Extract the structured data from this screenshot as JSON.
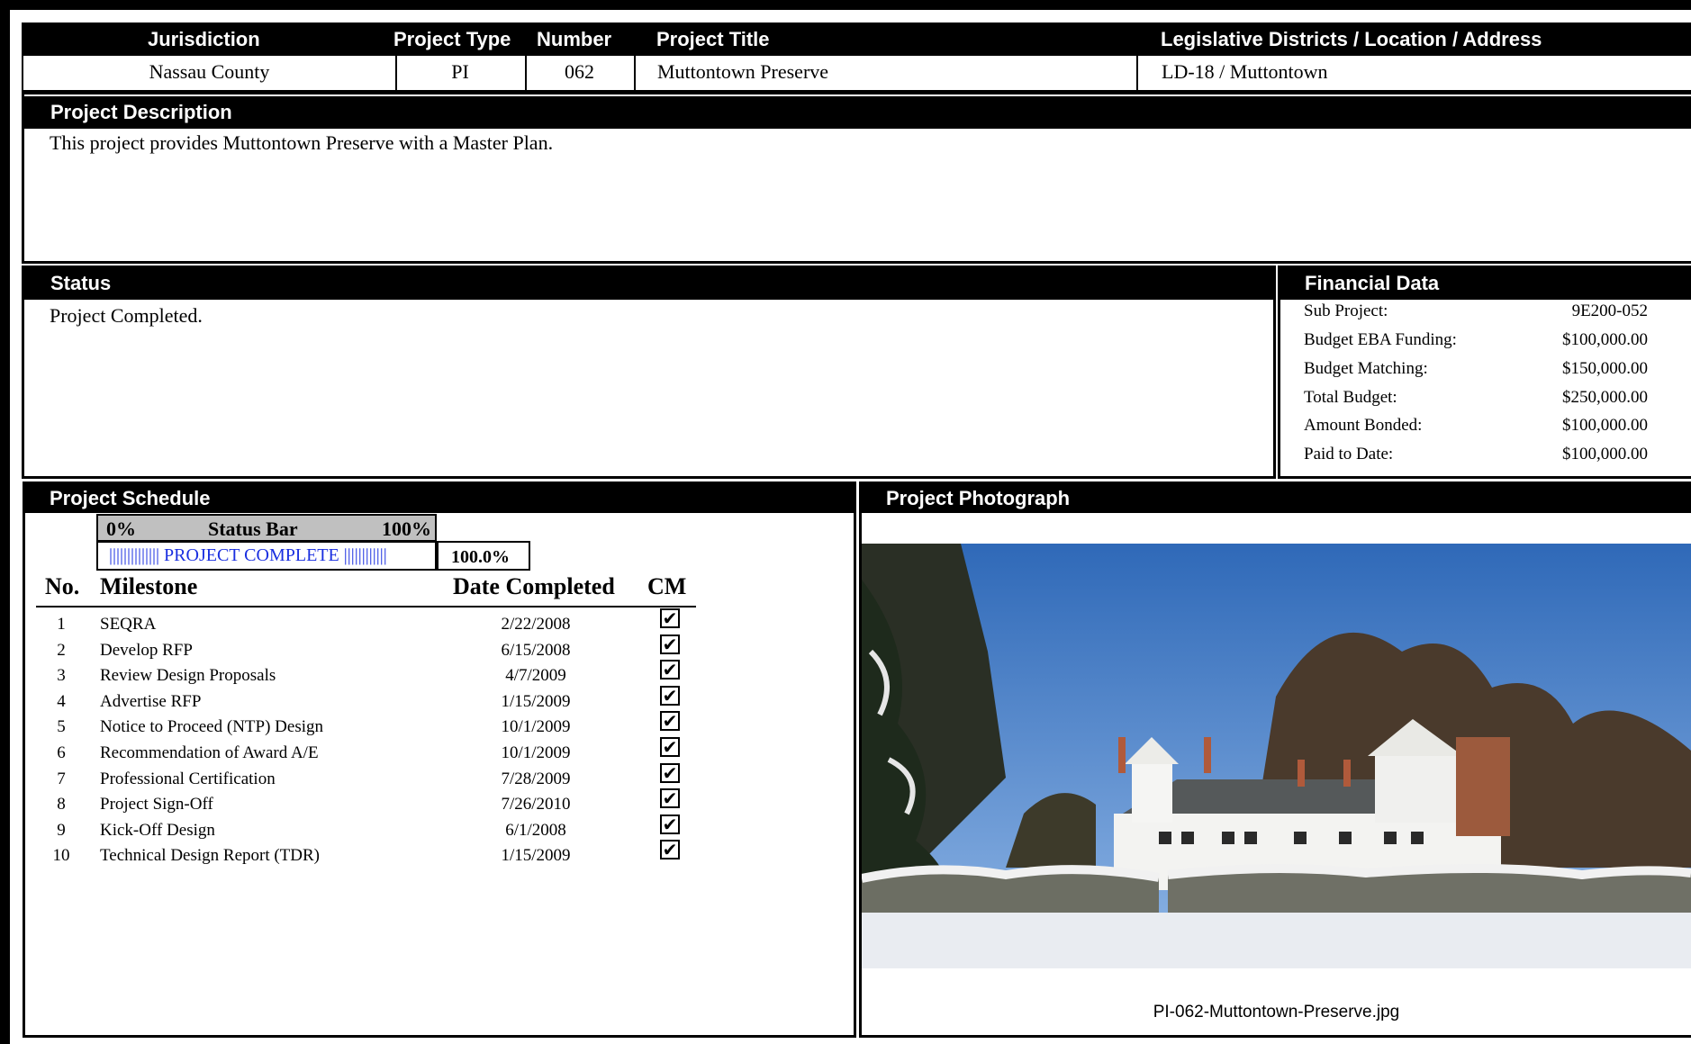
{
  "header": {
    "columns": {
      "jurisdiction": "Jurisdiction",
      "project_type": "Project Type",
      "number": "Number",
      "project_title": "Project Title",
      "location": "Legislative Districts / Location / Address"
    },
    "values": {
      "jurisdiction": "Nassau County",
      "project_type": "PI",
      "number": "062",
      "project_title": "Muttontown Preserve",
      "location": "LD-18 / Muttontown"
    }
  },
  "description": {
    "title": "Project Description",
    "text": "This project provides Muttontown Preserve with a Master Plan."
  },
  "status": {
    "title": "Status",
    "text": "Project Completed."
  },
  "financial": {
    "title": "Financial Data",
    "rows": [
      {
        "label": "Sub Project:",
        "value": "9E200-052"
      },
      {
        "label": "Budget EBA Funding:",
        "value": "$100,000.00"
      },
      {
        "label": "Budget Matching:",
        "value": "$150,000.00"
      },
      {
        "label": "Total Budget:",
        "value": "$250,000.00"
      },
      {
        "label": "Amount Bonded:",
        "value": "$100,000.00"
      },
      {
        "label": "Paid to Date:",
        "value": "$100,000.00"
      }
    ]
  },
  "schedule": {
    "title": "Project Schedule",
    "status_bar": {
      "min_label": "0%",
      "label": "Status Bar",
      "max_label": "100%",
      "text": "|||||||||||||| PROJECT COMPLETE ||||||||||||",
      "percent_text": "100.0%",
      "progress": 1.0
    },
    "columns": {
      "no": "No.",
      "milestone": "Milestone",
      "date": "Date Completed",
      "cm": "CM"
    },
    "milestones": [
      {
        "no": "1",
        "name": "SEQRA",
        "date": "2/22/2008",
        "cm": true
      },
      {
        "no": "2",
        "name": "Develop RFP",
        "date": "6/15/2008",
        "cm": true
      },
      {
        "no": "3",
        "name": "Review Design Proposals",
        "date": "4/7/2009",
        "cm": true
      },
      {
        "no": "4",
        "name": "Advertise RFP",
        "date": "1/15/2009",
        "cm": true
      },
      {
        "no": "5",
        "name": "Notice to Proceed (NTP) Design",
        "date": "10/1/2009",
        "cm": true
      },
      {
        "no": "6",
        "name": "Recommendation of Award A/E",
        "date": "10/1/2009",
        "cm": true
      },
      {
        "no": "7",
        "name": "Professional Certification",
        "date": "7/28/2009",
        "cm": true
      },
      {
        "no": "8",
        "name": "Project Sign-Off",
        "date": "7/26/2010",
        "cm": true
      },
      {
        "no": "9",
        "name": "Kick-Off Design",
        "date": "6/1/2008",
        "cm": true
      },
      {
        "no": "10",
        "name": "Technical Design Report (TDR)",
        "date": "1/15/2009",
        "cm": true
      }
    ],
    "check_glyph": "✔"
  },
  "photo": {
    "title": "Project Photograph",
    "caption": "PI-062-Muttontown-Preserve.jpg"
  }
}
